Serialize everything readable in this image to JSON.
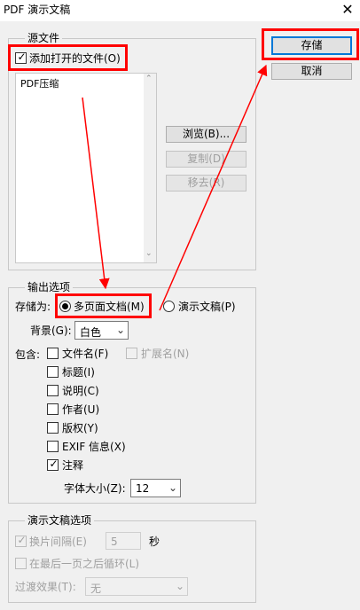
{
  "window": {
    "title": "PDF 演示文稿",
    "close_glyph": "✕"
  },
  "source": {
    "legend": "源文件",
    "add_open_files_label": "添加打开的文件(O)",
    "list_items": [
      "PDF压缩"
    ],
    "browse_label": "浏览(B)...",
    "duplicate_label": "复制(D)",
    "remove_label": "移去(R)"
  },
  "actions": {
    "save_label": "存储",
    "cancel_label": "取消"
  },
  "output": {
    "legend": "输出选项",
    "save_as_label": "存储为:",
    "multipage_label": "多页面文档(M)",
    "presentation_label": "演示文稿(P)",
    "background_label": "背景(G):",
    "background_value": "白色",
    "include_label": "包含:",
    "options": {
      "filename": "文件名(F)",
      "extension": "扩展名(N)",
      "title": "标题(I)",
      "description": "说明(C)",
      "author": "作者(U)",
      "copyright": "版权(Y)",
      "exif": "EXIF 信息(X)",
      "annotations": "注释"
    },
    "font_size_label": "字体大小(Z):",
    "font_size_value": "12"
  },
  "presentation": {
    "legend": "演示文稿选项",
    "advance_label": "换片间隔(E)",
    "advance_value": "5",
    "seconds_unit": "秒",
    "loop_label": "在最后一页之后循环(L)",
    "transition_label": "过渡效果(T):",
    "transition_value": "无"
  },
  "colors": {
    "annotation_red": "#ff0000",
    "focus_blue": "#0078d7"
  }
}
